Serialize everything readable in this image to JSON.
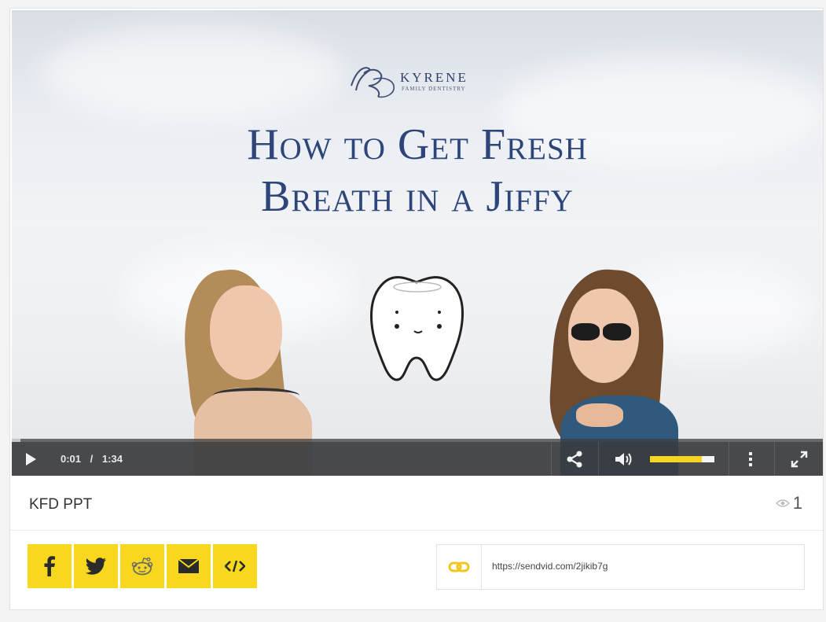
{
  "player": {
    "brand_name": "KYRENE",
    "brand_sub": "FAMILY DENTISTRY",
    "headline_line1": "How to Get Fresh",
    "headline_line2": "Breath in a Jiffy",
    "time": "0:01",
    "time_sep": "/",
    "duration": "1:34",
    "progress": 0.011,
    "volume": 0.8
  },
  "video": {
    "title": "KFD PPT",
    "views": "1"
  },
  "share": {
    "buttons": [
      "facebook-icon",
      "twitter-icon",
      "reddit-icon",
      "email-icon",
      "embed-icon"
    ],
    "link": "https://sendvid.com/2jikib7g"
  },
  "colors": {
    "accent": "#f8d81e",
    "headline": "#2d4578",
    "controls_bg": "#3a3c3f"
  }
}
